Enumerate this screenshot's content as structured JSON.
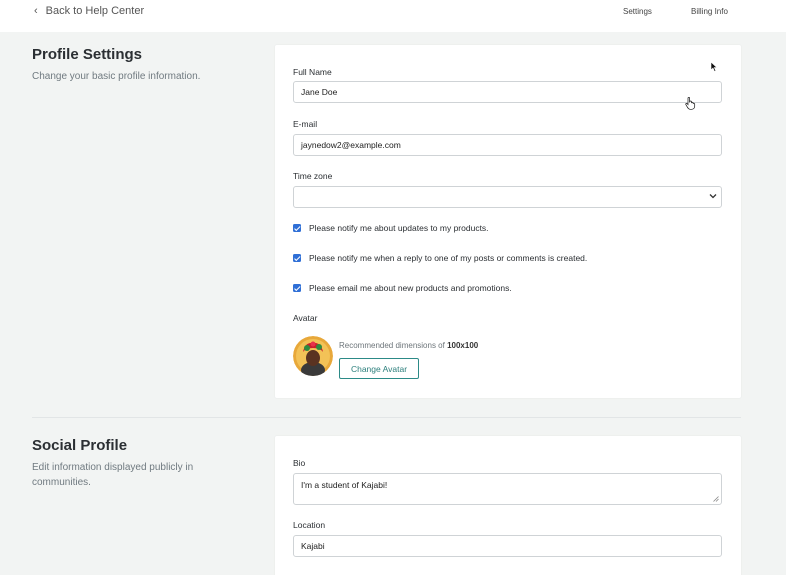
{
  "topbar": {
    "back_label": "Back to Help Center",
    "nav": [
      "Settings",
      "Billing Info"
    ]
  },
  "profile": {
    "title": "Profile Settings",
    "description": "Change your basic profile information.",
    "full_name_label": "Full Name",
    "full_name_value": "Jane Doe",
    "email_label": "E-mail",
    "email_value": "jaynedow2@example.com",
    "timezone_label": "Time zone",
    "timezone_value": "",
    "checkboxes": [
      {
        "label": "Please notify me about updates to my products.",
        "checked": true
      },
      {
        "label": "Please notify me when a reply to one of my posts or comments is created.",
        "checked": true
      },
      {
        "label": "Please email me about new products and promotions.",
        "checked": true
      }
    ],
    "avatar_label": "Avatar",
    "avatar_hint_prefix": "Recommended dimensions of",
    "avatar_hint_dims": "100x100",
    "change_avatar_label": "Change Avatar"
  },
  "social": {
    "title": "Social Profile",
    "description": "Edit information displayed publicly in communities.",
    "bio_label": "Bio",
    "bio_value": "I'm a student of Kajabi!",
    "location_label": "Location",
    "location_value": "Kajabi"
  },
  "colors": {
    "background": "#f2f4f3",
    "accent": "#2c8a87",
    "checkbox": "#2f6fd6"
  }
}
